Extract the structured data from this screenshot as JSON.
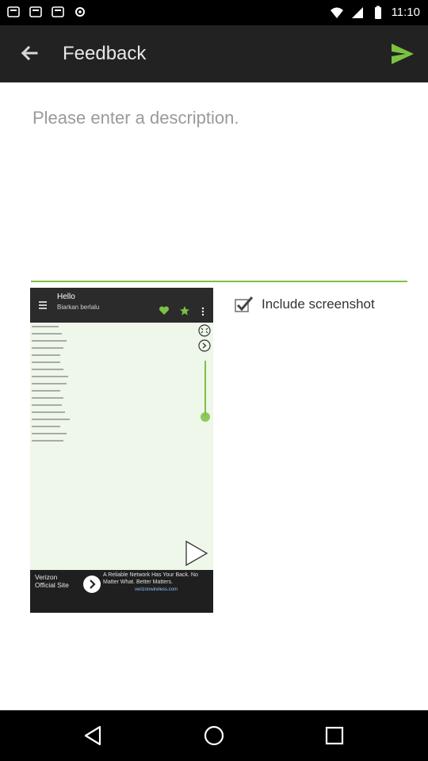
{
  "status_bar": {
    "time": "11:10"
  },
  "app_bar": {
    "title": "Feedback"
  },
  "description": {
    "placeholder": "Please enter a description.",
    "value": ""
  },
  "include_screenshot": {
    "label": "Include screenshot",
    "checked": true
  },
  "screenshot_preview": {
    "app_title": "Hello",
    "app_subtitle": "Biarkan berlalu",
    "ad_brand": "Verizon Official Site",
    "ad_text": "A Reliable Network Has Your Back. No Matter What. Better Matters.",
    "ad_url": "verizonwireless.com"
  },
  "colors": {
    "accent": "#7cc242",
    "app_bar": "#222222",
    "status_bar": "#000000"
  },
  "icons": [
    "back-arrow-icon",
    "send-icon",
    "checkmark-icon",
    "nav-back-icon",
    "nav-home-icon",
    "nav-recents-icon"
  ]
}
